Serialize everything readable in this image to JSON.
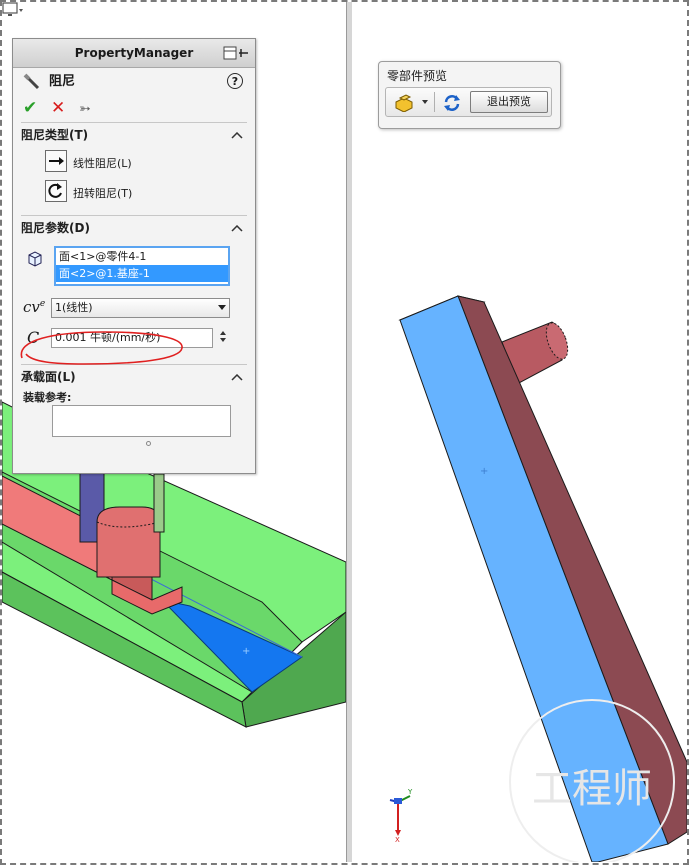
{
  "property_manager": {
    "header_title": "PropertyManager",
    "feature_title": "阻尼",
    "help_label": "?",
    "ok_glyph": "✔",
    "cancel_glyph": "✕",
    "pin_glyph": "➳"
  },
  "damper_type": {
    "title": "阻尼类型(T)",
    "options": [
      "线性阻尼(L)",
      "扭转阻尼(T)"
    ]
  },
  "damper_params": {
    "title": "阻尼参数(D)",
    "faces": [
      "面<1>@零件4-1",
      "面<2>@1.基座-1"
    ],
    "selected_face_index": 1,
    "exponent_value": "1(线性)",
    "coefficient_value": "0.001 牛顿/(mm/秒)",
    "cv_symbol": "cv",
    "cv_superscript": "e",
    "c_symbol": "C"
  },
  "load_bearing": {
    "title": "承载面(L)",
    "assembly_ref_label": "装载参考:"
  },
  "part_preview": {
    "title": "零部件预览",
    "exit_button": "退出预览"
  },
  "colors": {
    "selected_face_blue": "#66b3ff",
    "part_brown": "#8c4a52",
    "base_green": "#7cf07c",
    "ok_green": "#2aa02a",
    "cancel_red": "#d81c1c",
    "annotation_red": "#e02020"
  },
  "icons": {
    "monitor": "monitor-icon",
    "damper": "damper-icon",
    "linear_arrow": "linear-arrow-icon",
    "torsion": "rotate-icon",
    "face_select": "face-select-icon",
    "part": "part-icon",
    "refresh": "refresh-icon"
  }
}
